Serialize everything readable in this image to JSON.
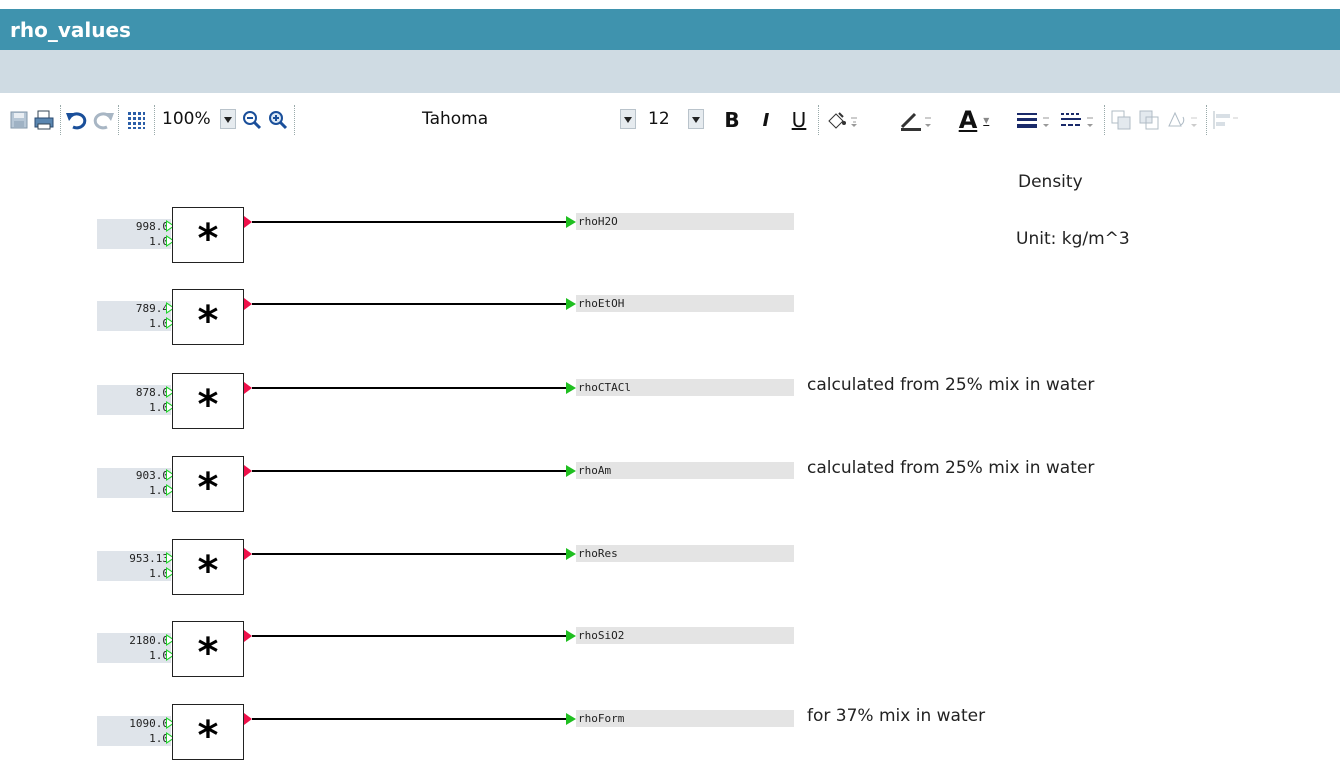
{
  "window": {
    "title": "rho_values"
  },
  "toolbar": {
    "zoom": "100%",
    "font_name": "Tahoma",
    "font_size": "12",
    "bold": "B",
    "italic": "I",
    "underline": "U",
    "text_color_glyph": "A",
    "icons": [
      "save-icon",
      "print-icon",
      "undo-icon",
      "redo-icon",
      "grid-icon",
      "zoom-out-icon",
      "zoom-in-icon",
      "fill-color-icon",
      "line-color-icon",
      "text-color-icon",
      "line-width-icon",
      "line-style-icon",
      "bring-front-icon",
      "send-back-icon",
      "rotate-icon",
      "align-left-icon"
    ]
  },
  "canvas": {
    "header_label": "Density",
    "unit_label": "Unit: kg/m^3",
    "operator": "*",
    "rows": [
      {
        "input": "998.0",
        "factor": "1.0",
        "output": "rhoH2O",
        "note": ""
      },
      {
        "input": "789.4",
        "factor": "1.0",
        "output": "rhoEtOH",
        "note": ""
      },
      {
        "input": "878.0",
        "factor": "1.0",
        "output": "rhoCTACl",
        "note": "calculated from 25% mix in water"
      },
      {
        "input": "903.0",
        "factor": "1.0",
        "output": "rhoAm",
        "note": "calculated from 25% mix in water"
      },
      {
        "input": "953.13",
        "factor": "1.0",
        "output": "rhoRes",
        "note": ""
      },
      {
        "input": "2180.0",
        "factor": "1.0",
        "output": "rhoSiO2",
        "note": ""
      },
      {
        "input": "1090.0",
        "factor": "1.0",
        "output": "rhoForm",
        "note": "for 37% mix in water"
      }
    ]
  },
  "colors": {
    "titlebar": "#3f93ae",
    "band": "#cfdbe3",
    "input_port": "#1fd12a",
    "output_port": "#f0104a",
    "signal_arrow": "#1fbf20"
  }
}
